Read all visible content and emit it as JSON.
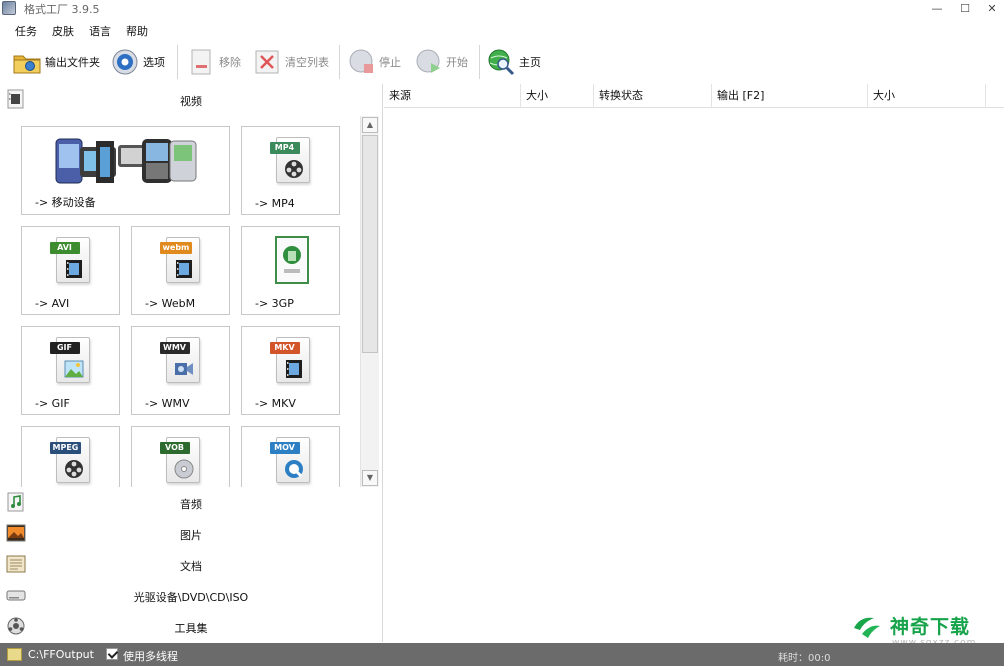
{
  "window": {
    "title": "格式工厂 3.9.5",
    "controls": [
      "minimize",
      "maximize",
      "close"
    ]
  },
  "menu": [
    "任务",
    "皮肤",
    "语言",
    "帮助"
  ],
  "toolbar": {
    "output_folder": "输出文件夹",
    "options": "选项",
    "remove": "移除",
    "clear_list": "清空列表",
    "stop": "停止",
    "start": "开始",
    "home": "主页"
  },
  "categories": {
    "video": "视频",
    "audio": "音频",
    "picture": "图片",
    "document": "文档",
    "rom": "光驱设备\\DVD\\CD\\ISO",
    "toolbox": "工具集"
  },
  "video_tiles": [
    {
      "label": "-> 移动设备",
      "tag": "",
      "tag_color": ""
    },
    {
      "label": "-> MP4",
      "tag": "MP4",
      "tag_color": "#3a8a5c"
    },
    {
      "label": "-> AVI",
      "tag": "AVI",
      "tag_color": "#3d8c2f"
    },
    {
      "label": "-> WebM",
      "tag": "webm",
      "tag_color": "#e08a1e"
    },
    {
      "label": "-> 3GP",
      "tag": "",
      "tag_color": "#2f8f3e"
    },
    {
      "label": "-> GIF",
      "tag": "GIF",
      "tag_color": "#222222"
    },
    {
      "label": "-> WMV",
      "tag": "WMV",
      "tag_color": "#2a2a2a"
    },
    {
      "label": "-> MKV",
      "tag": "MKV",
      "tag_color": "#d2552a"
    },
    {
      "label": "",
      "tag": "MPEG",
      "tag_color": "#2a4f7a"
    },
    {
      "label": "",
      "tag": "VOB",
      "tag_color": "#2d6a2d"
    },
    {
      "label": "",
      "tag": "MOV",
      "tag_color": "#2d7fc4"
    }
  ],
  "table": {
    "columns": [
      "来源",
      "大小",
      "转换状态",
      "输出 [F2]",
      "大小"
    ]
  },
  "status": {
    "output_path": "C:\\FFOutput",
    "multithread_label": "使用多线程",
    "multithread_checked": true,
    "elapsed_label": "耗时：00:0"
  },
  "watermark": {
    "title": "神奇下载",
    "url": "www.sqxzz.com"
  }
}
